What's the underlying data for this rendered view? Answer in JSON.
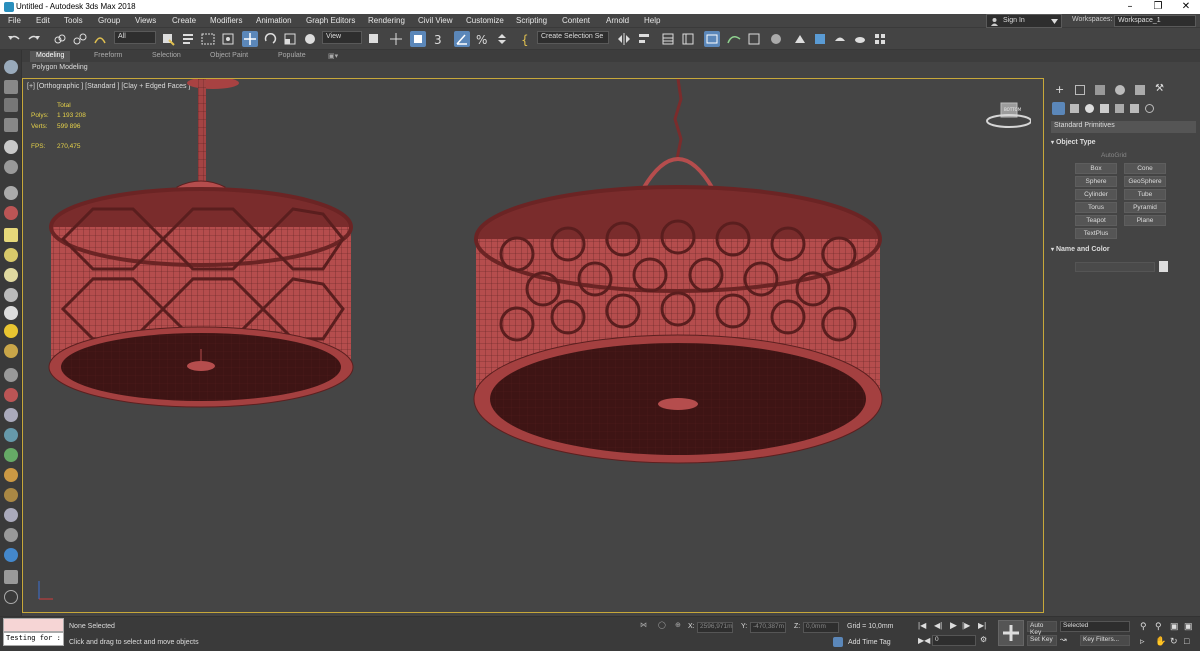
{
  "window": {
    "title": "Untitled - Autodesk 3ds Max 2018"
  },
  "menu": [
    "File",
    "Edit",
    "Tools",
    "Group",
    "Views",
    "Create",
    "Modifiers",
    "Animation",
    "Graph Editors",
    "Rendering",
    "Civil View",
    "Customize",
    "Scripting",
    "Content",
    "Arnold",
    "Help"
  ],
  "signin": "Sign In",
  "workspaces": {
    "label": "Workspaces:",
    "value": "Workspace_1"
  },
  "toolbar": {
    "selection_filter": "All",
    "ref_coord": "View",
    "named_selection": "Create Selection Se"
  },
  "ribbon_tabs": [
    "Modeling",
    "Freeform",
    "Selection",
    "Object Paint",
    "Populate"
  ],
  "ribbon_sub": "Polygon Modeling",
  "viewport": {
    "label": "[+] [Orthographic ] [Standard ] [Clay + Edged Faces ]",
    "stats_total": "Total",
    "polys_label": "Polys:",
    "polys_value": "1 193 208",
    "verts_label": "Verts:",
    "verts_value": "599 896",
    "fps_label": "FPS:",
    "fps_value": "270,475",
    "viewcube": "BOTTOM"
  },
  "command_panel": {
    "category": "Standard Primitives",
    "object_type_title": "Object Type",
    "autogrid": "AutoGrid",
    "buttons": [
      "Box",
      "Cone",
      "Sphere",
      "GeoSphere",
      "Cylinder",
      "Tube",
      "Torus",
      "Pyramid",
      "Teapot",
      "Plane",
      "TextPlus"
    ],
    "name_color_title": "Name and Color"
  },
  "status": {
    "maxscript": "Testing for :",
    "selected": "None Selected",
    "prompt": "Click and drag to select and move objects",
    "x_label": "X:",
    "x_value": "2596,971m",
    "y_label": "Y:",
    "y_value": "-470,387m",
    "z_label": "Z:",
    "z_value": "0,0mm",
    "grid": "Grid = 10,0mm",
    "add_time_tag": "Add Time Tag",
    "frame": "0",
    "auto_key": "Auto Key",
    "set_key": "Set Key",
    "selected_dd": "Selected",
    "key_filters": "Key Filters..."
  },
  "colors": {
    "accent": "#5b87b9",
    "viewport_border": "#c7a83a",
    "mesh": "#c85a58",
    "mesh_dark": "#3d1515"
  }
}
